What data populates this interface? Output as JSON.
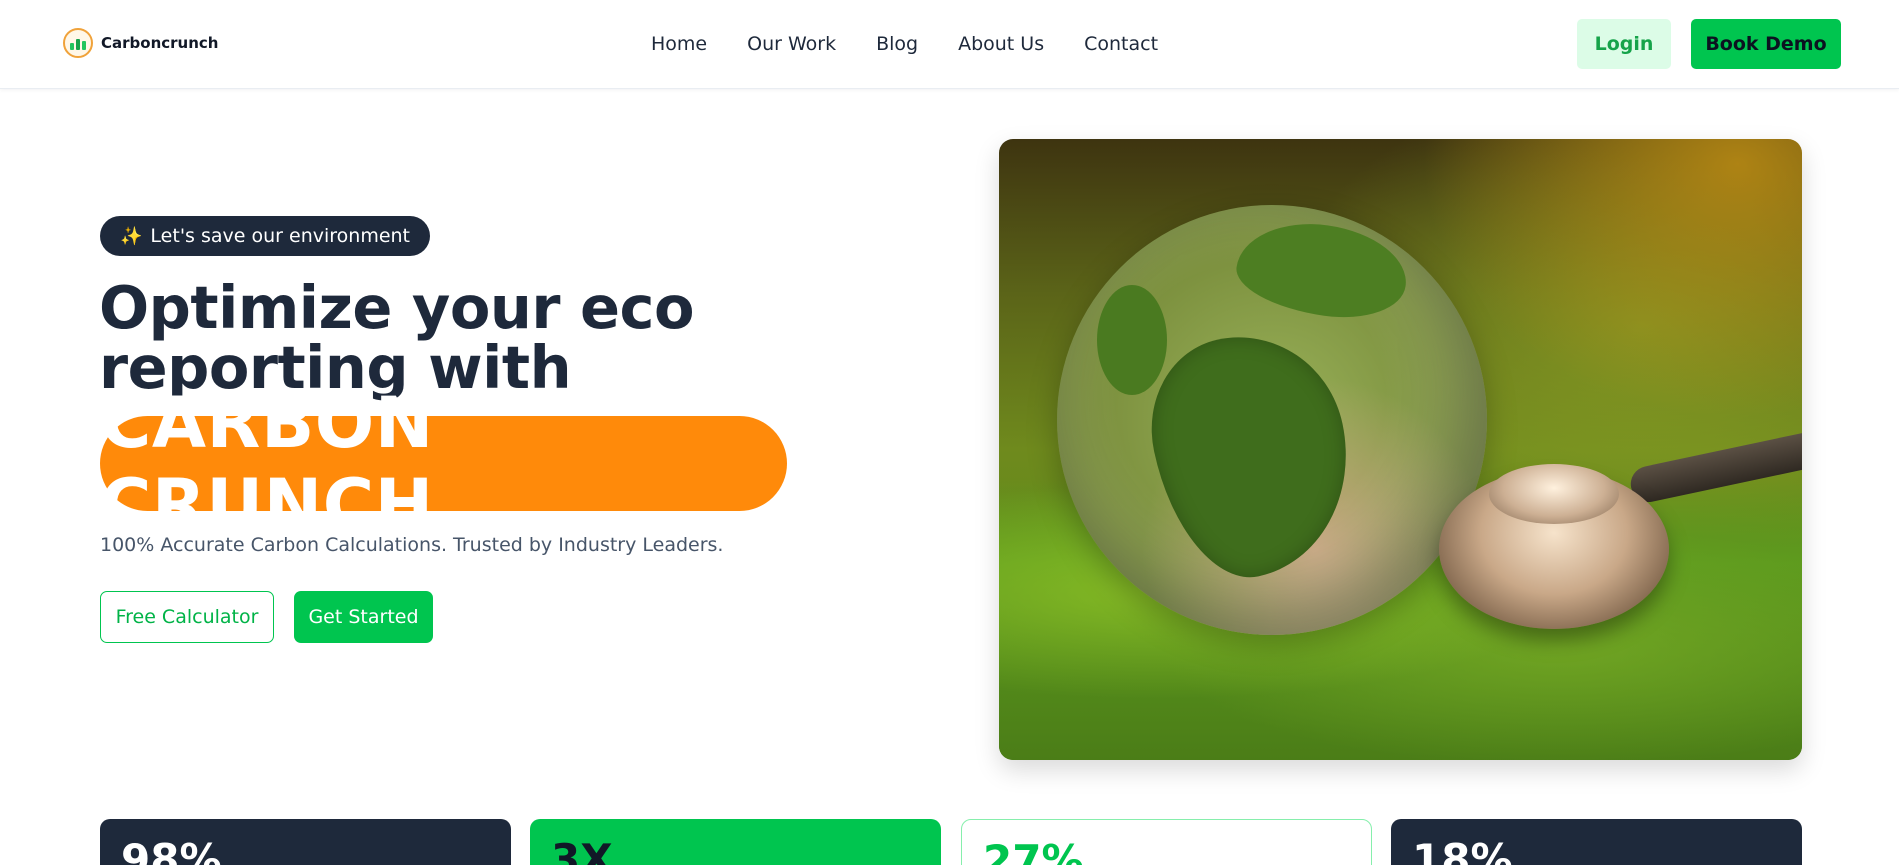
{
  "header": {
    "brand": {
      "name": "Carboncrunch",
      "icon": "carboncrunch-logo-icon"
    },
    "nav": [
      {
        "label": "Home"
      },
      {
        "label": "Our Work"
      },
      {
        "label": "Blog"
      },
      {
        "label": "About Us"
      },
      {
        "label": "Contact"
      }
    ],
    "login_label": "Login",
    "demo_label": "Book Demo"
  },
  "hero": {
    "badge": {
      "icon": "sparkle-icon",
      "glyph": "✨",
      "text": "Let's save our environment"
    },
    "headline": "Optimize your eco reporting with",
    "brand_highlight": "CARBON CRUNCH",
    "subtext": "100% Accurate Carbon Calculations. Trusted by Industry Leaders.",
    "buttons": {
      "calculator": "Free Calculator",
      "get_started": "Get Started"
    },
    "image": {
      "subject": "glass-globe-with-stethoscope-on-moss"
    }
  },
  "stats": [
    {
      "value": "98%",
      "style": "dark"
    },
    {
      "value": "3X",
      "style": "green"
    },
    {
      "value": "27%",
      "style": "light"
    },
    {
      "value": "18%",
      "style": "dark"
    }
  ],
  "colors": {
    "accent_green": "#00c54f",
    "accent_orange": "#ff8a0a",
    "navy": "#1e293b",
    "login_bg": "#dcfce7"
  }
}
